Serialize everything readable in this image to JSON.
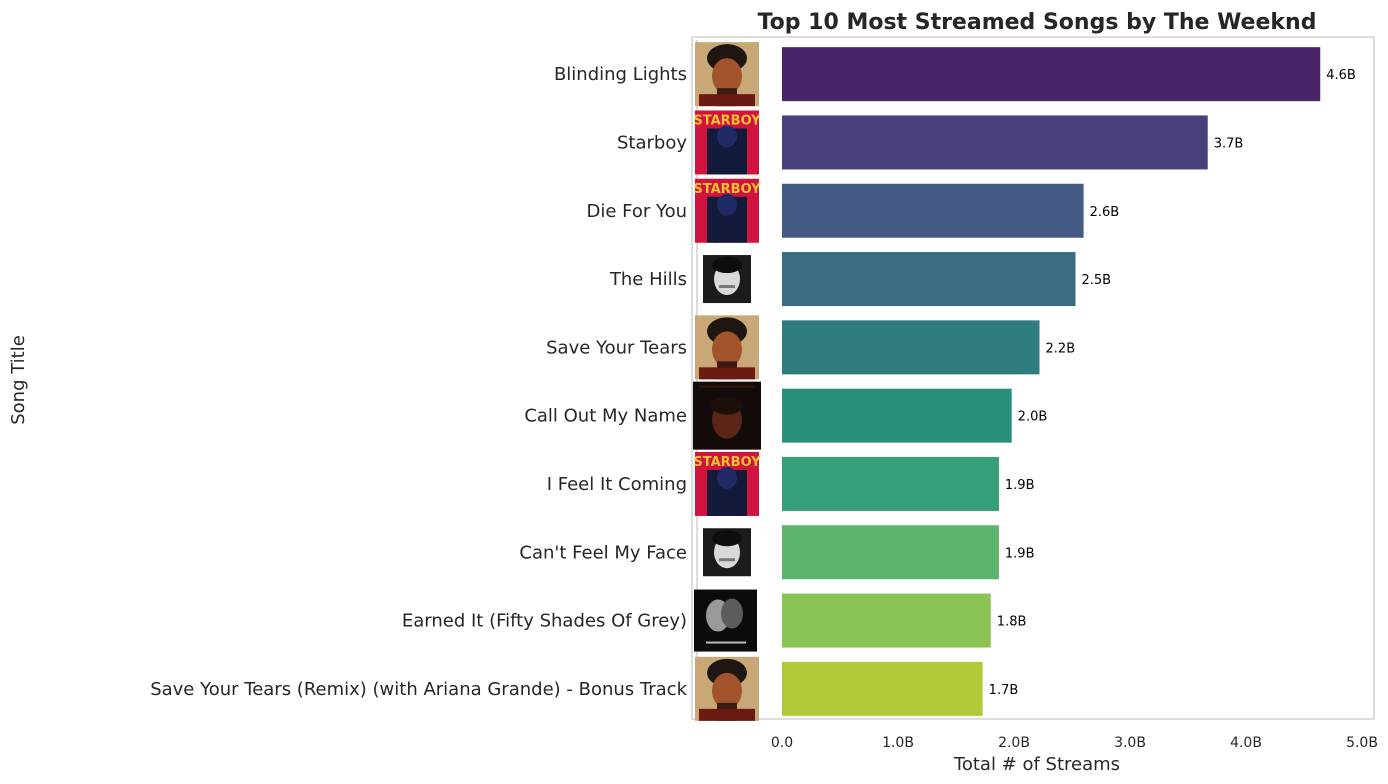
{
  "chart_data": {
    "type": "bar",
    "orientation": "horizontal",
    "title": "Top 10 Most Streamed Songs by The Weeknd",
    "xlabel": "Total # of Streams",
    "ylabel": "Song Title",
    "xlim": [
      0,
      5.0
    ],
    "x_unit": "billion streams",
    "xticks": [
      0.0,
      1.0,
      2.0,
      3.0,
      4.0,
      5.0
    ],
    "xtick_labels": [
      "0.0",
      "1.0B",
      "2.0B",
      "3.0B",
      "4.0B",
      "5.0B"
    ],
    "grid": false,
    "categories": [
      "Blinding Lights",
      "Starboy",
      "Die For You",
      "The Hills",
      "Save Your Tears",
      "Call Out My Name",
      "I Feel It Coming",
      "Can't Feel My Face",
      "Earned It (Fifty Shades Of Grey)",
      "Save Your Tears (Remix) (with Ariana Grande) - Bonus Track"
    ],
    "values": [
      4.64,
      3.67,
      2.6,
      2.53,
      2.22,
      1.98,
      1.87,
      1.87,
      1.8,
      1.73
    ],
    "data_labels": [
      "4.6B",
      "3.7B",
      "2.6B",
      "2.5B",
      "2.2B",
      "2.0B",
      "1.9B",
      "1.9B",
      "1.8B",
      "1.7B"
    ],
    "album_covers": [
      "after-hours-cover",
      "starboy-cover",
      "starboy-cover",
      "beauty-behind-the-madness-cover",
      "after-hours-cover",
      "my-dear-melancholy-cover",
      "starboy-cover",
      "beauty-behind-the-madness-cover",
      "fifty-shades-of-grey-cover",
      "after-hours-cover"
    ],
    "colors": [
      "#482466",
      "#46407c",
      "#425a84",
      "#386d80",
      "#2f7d80",
      "#2a8f7d",
      "#35a077",
      "#5db46a",
      "#8ac455",
      "#b2c836"
    ]
  }
}
